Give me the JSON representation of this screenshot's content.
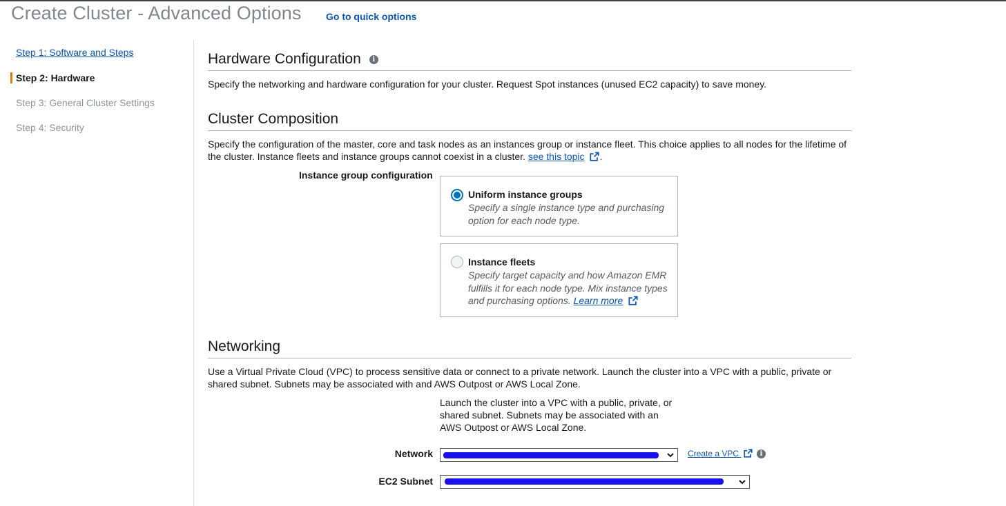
{
  "header": {
    "title": "Create Cluster - Advanced Options",
    "quick_options_link": "Go to quick options"
  },
  "sidebar": {
    "steps": [
      {
        "label": "Step 1: Software and Steps",
        "state": "link"
      },
      {
        "label": "Step 2: Hardware",
        "state": "active"
      },
      {
        "label": "Step 3: General Cluster Settings",
        "state": "disabled"
      },
      {
        "label": "Step 4: Security",
        "state": "disabled"
      }
    ]
  },
  "hardware": {
    "heading": "Hardware Configuration",
    "info_icon": "info-icon",
    "description": "Specify the networking and hardware configuration for your cluster. Request Spot instances (unused EC2 capacity) to save money."
  },
  "composition": {
    "heading": "Cluster Composition",
    "description": "Specify the configuration of the master, core and task nodes as an instances group or instance fleet. This choice applies to all nodes for the lifetime of the cluster. Instance fleets and instance groups cannot coexist in a cluster.",
    "see_topic_link": "see this topic",
    "trailing_period": ".",
    "instance_group_label": "Instance group configuration",
    "options": [
      {
        "title": "Uniform instance groups",
        "description": "Specify a single instance type and purchasing option for each node type.",
        "selected": true
      },
      {
        "title": "Instance fleets",
        "description": "Specify target capacity and how Amazon EMR fulfills it for each node type. Mix instance types and purchasing options.",
        "learn_more": "Learn more",
        "selected": false
      }
    ]
  },
  "networking": {
    "heading": "Networking",
    "description": "Use a Virtual Private Cloud (VPC) to process sensitive data or connect to a private network. Launch the cluster into a VPC with a public, private or shared subnet. Subnets may be associated with and AWS Outpost or AWS Local Zone.",
    "note": "Launch the cluster into a VPC with a public, private, or shared subnet. Subnets may be associated with an AWS Outpost or AWS Local Zone.",
    "network_label": "Network",
    "network_value": "",
    "create_vpc_link": "Create a VPC",
    "subnet_label": "EC2 Subnet",
    "subnet_value": ""
  },
  "colors": {
    "link": "#0a56b0",
    "active_step_marker": "#e07c00",
    "radio_selected": "#0073bb",
    "redaction": "#1a12ee"
  }
}
